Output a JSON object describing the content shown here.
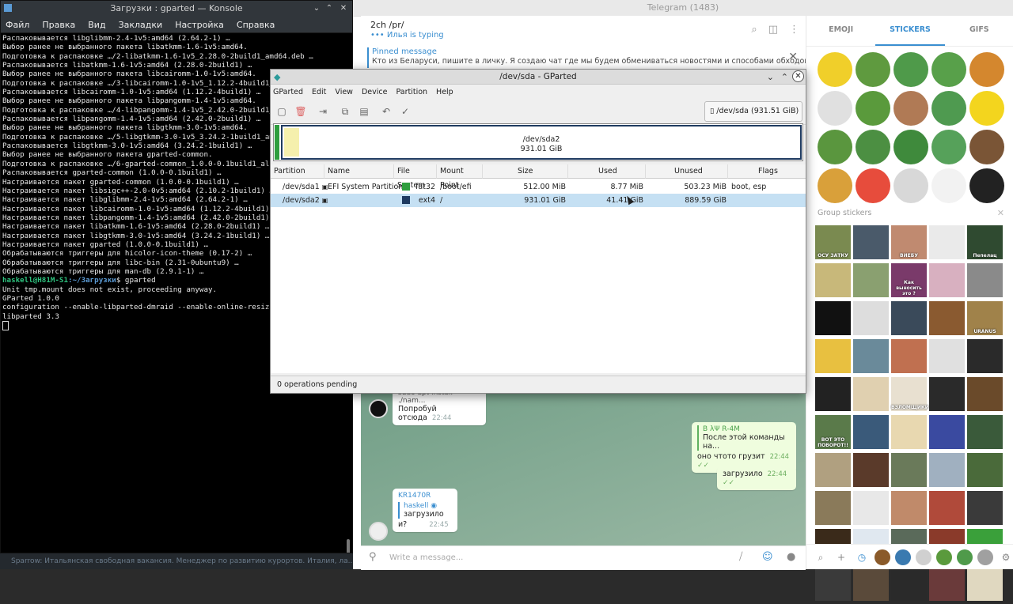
{
  "konsole": {
    "title": "Загрузки : gparted — Konsole",
    "menu": [
      "Файл",
      "Правка",
      "Вид",
      "Закладки",
      "Настройка",
      "Справка"
    ],
    "lines": [
      "Распаковывается libglibmm-2.4-1v5:amd64 (2.64.2-1) …",
      "Выбор ранее не выбранного пакета libatkmm-1.6-1v5:amd64.",
      "Подготовка к распаковке …/2-libatkmm-1.6-1v5_2.28.0-2build1_amd64.deb …",
      "Распаковывается libatkmm-1.6-1v5:amd64 (2.28.0-2build1) …",
      "Выбор ранее не выбранного пакета libcairomm-1.0-1v5:amd64.",
      "Подготовка к распаковке …/3-libcairomm-1.0-1v5_1.12.2-4build1_am",
      "Распаковывается libcairomm-1.0-1v5:amd64 (1.12.2-4build1) …",
      "Выбор ранее не выбранного пакета libpangomm-1.4-1v5:amd64.",
      "Подготовка к распаковке …/4-libpangomm-1.4-1v5_2.42.0-2build1_am",
      "Распаковывается libpangomm-1.4-1v5:amd64 (2.42.0-2build1) …",
      "Выбор ранее не выбранного пакета libgtkmm-3.0-1v5:amd64.",
      "Подготовка к распаковке …/5-libgtkmm-3.0-1v5_3.24.2-1build1_amd64",
      "Распаковывается libgtkmm-3.0-1v5:amd64 (3.24.2-1build1) …",
      "Выбор ранее не выбранного пакета gparted-common.",
      "Подготовка к распаковке …/6-gparted-common_1.0.0-0.1build1_all.d",
      "Распаковывается gparted-common (1.0.0-0.1build1) …",
      "Настраивается пакет gparted-common (1.0.0-0.1build1) …",
      "Настраивается пакет libsigc++-2.0-0v5:amd64 (2.10.2-1build1) …",
      "Настраивается пакет libglibmm-2.4-1v5:amd64 (2.64.2-1) …",
      "Настраивается пакет libcairomm-1.0-1v5:amd64 (1.12.2-4build1) …",
      "Настраивается пакет libpangomm-1.4-1v5:amd64 (2.42.0-2build1) …",
      "Настраивается пакет libatkmm-1.6-1v5:amd64 (2.28.0-2build1) …",
      "Настраивается пакет libgtkmm-3.0-1v5:amd64 (3.24.2-1build1) …",
      "Настраивается пакет gparted (1.0.0-0.1build1) …",
      "Обрабатываются триггеры для hicolor-icon-theme (0.17-2) …",
      "Обрабатываются триггеры для libc-bin (2.31-0ubuntu9) …",
      "Обрабатываются триггеры для man-db (2.9.1-1) …"
    ],
    "prompt_user": "haskell@H81M-S1",
    "prompt_dir": ":~/Загрузки",
    "prompt_cmd": "$ gparted",
    "after_lines": [
      "Unit tmp.mount does not exist, proceeding anyway.",
      "GParted 1.0.0",
      "configuration --enable-libparted-dmraid --enable-online-resize",
      "libparted 3.3"
    ]
  },
  "telegram": {
    "title": "Telegram (1483)",
    "chat_title": "2ch /pr/",
    "typing": "••• Илья is typing",
    "pinned_title": "Pinned message",
    "pinned_text": "Кто из Беларуси, пишите в личку. Я создаю чат где мы будем обмениваться новостями и способами обходов глобаль...",
    "messages": {
      "m1_quote": "sudo apt install ./nam...",
      "m1_text": "Попробуй отсюда",
      "m1_time": "22:44",
      "m2_quote_name": "В λΨ R-4M",
      "m2_quote_text": "После этой команды на...",
      "m2_text": "оно чтото грузит",
      "m2_time": "22:44",
      "m3_text": "загрузило",
      "m3_time": "22:44",
      "m4_name": "KR1470R",
      "m4_quote_name": "haskell",
      "m4_quote_text": "загрузило",
      "m4_text": "и?",
      "m4_time": "22:45"
    },
    "input_placeholder": "Write a message...",
    "taskbar_hint": "Sparrow: Итальянская свободная вакансия. Менеджер по развитию курортов. Италия, ла..."
  },
  "stickers": {
    "tabs": [
      "EMOJI",
      "STICKERS",
      "GIFS"
    ],
    "active_tab": "STICKERS",
    "group_label": "Group stickers",
    "top_colors": [
      "#f0cf2a",
      "#5f9a3f",
      "#4f9a4a",
      "#58a04a",
      "#d4872e",
      "#e0e0e0",
      "#5a9a3c",
      "#b07a55",
      "#4f9a50",
      "#f3d51e",
      "#5a963e",
      "#4c8f42",
      "#3f8a3c",
      "#56a15a",
      "#7a5536",
      "#d9a03a",
      "#e74c3c",
      "#d8d8d8",
      "#f2f2f2",
      "#222222"
    ],
    "group_captions": [
      "ОСУ ЗАТКУ",
      "",
      "ВИЕБУ",
      "",
      "Пепелац",
      "",
      "",
      "Как выносить это ?",
      "",
      "",
      "",
      "",
      "",
      "",
      "URANUS",
      "",
      "",
      "",
      "",
      "",
      "",
      "",
      "ВЗЛОМЩИКИ",
      "",
      "",
      "ВОТ ЭТО ПОВОРОТ!!",
      "",
      "",
      "",
      "",
      "",
      "",
      "",
      "",
      "",
      "",
      "",
      "",
      "",
      "",
      "",
      "",
      "",
      "",
      "",
      "",
      "",
      "",
      "",
      ""
    ],
    "group_colors": [
      "#7a8a50",
      "#4a5a6a",
      "#c08a70",
      "#eaeaea",
      "#2f4a30",
      "#c8b87a",
      "#8aa070",
      "#7a3a6a",
      "#d8b0c0",
      "#8a8a8a",
      "#111111",
      "#dddddd",
      "#3a4a5a",
      "#8a5a30",
      "#a0824a",
      "#e8c040",
      "#6a8a9a",
      "#c07050",
      "#e0e0e0",
      "#2a2a2a",
      "#222222",
      "#e0d0b0",
      "#e8e0d0",
      "#2a2a2a",
      "#6a4a2a",
      "#5a7a4a",
      "#3a5a7a",
      "#e8d8b0",
      "#3a4aa0",
      "#3a5a3a",
      "#b0a080",
      "#5a3a2a",
      "#6a7a5a",
      "#a0b0c0",
      "#4a6a3a",
      "#8a7a5a",
      "#e8e8e8",
      "#c08a6a",
      "#b04a3a",
      "#3a3a3a",
      "#3a2a1a",
      "#e0e8f0",
      "#5a6a5a",
      "#8a3a2a",
      "#3aa03a",
      "#3a3a3a",
      "#5a4a3a",
      "#2a2a2a",
      "#6a3a3a",
      "#e0d8c0"
    ]
  },
  "gparted": {
    "title": "/dev/sda - GParted",
    "menu": [
      "GParted",
      "Edit",
      "View",
      "Device",
      "Partition",
      "Help"
    ],
    "device": "/dev/sda (931.51 GiB)",
    "disk_label": "/dev/sda2",
    "disk_size": "931.01 GiB",
    "columns": [
      "Partition",
      "Name",
      "File System",
      "Mount Point",
      "Size",
      "Used",
      "Unused",
      "Flags"
    ],
    "rows": [
      {
        "partition": "/dev/sda1",
        "name": "EFI System Partition",
        "fs": "fat32",
        "fs_color": "#2e9e3e",
        "mount": "/boot/efi",
        "size": "512.00 MiB",
        "used": "8.77 MiB",
        "unused": "503.23 MiB",
        "flags": "boot, esp"
      },
      {
        "partition": "/dev/sda2",
        "name": "",
        "fs": "ext4",
        "fs_color": "#1e3a60",
        "mount": "/",
        "size": "931.01 GiB",
        "used": "41.41 GiB",
        "unused": "889.59 GiB",
        "flags": ""
      }
    ],
    "used_fraction": 0.044,
    "status": "0 operations pending"
  }
}
